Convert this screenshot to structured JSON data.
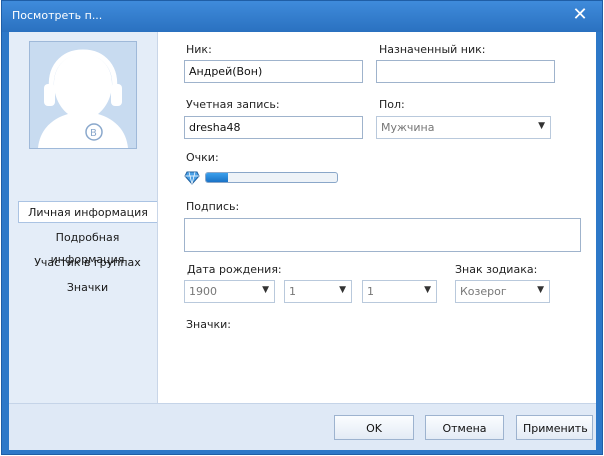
{
  "window": {
    "title": "Посмотреть п..."
  },
  "sidebar": {
    "items": [
      {
        "label": "Личная информация",
        "active": true
      },
      {
        "label": "Подробная информация",
        "active": false
      },
      {
        "label": "Участик в группах",
        "active": false
      },
      {
        "label": "Значки",
        "active": false
      }
    ]
  },
  "form": {
    "nick": {
      "label": "Ник:",
      "value": "Андрей(Вон)"
    },
    "assigned_nick": {
      "label": "Назначенный ник:",
      "value": ""
    },
    "account": {
      "label": "Учетная запись:",
      "value": "dresha48"
    },
    "gender": {
      "label": "Пол:",
      "value": "Мужчина"
    },
    "points": {
      "label": "Очки:",
      "progress_fraction": 0.17
    },
    "signature": {
      "label": "Подпись:",
      "value": ""
    },
    "birthdate": {
      "label": "Дата рождения:",
      "year": "1900",
      "month": "1",
      "day": "1"
    },
    "zodiac": {
      "label": "Знак зодиака:",
      "value": "Козерог"
    },
    "badges": {
      "label": "Значки:"
    }
  },
  "footer": {
    "ok": "OK",
    "cancel": "Отмена",
    "apply": "Применить"
  },
  "colors": {
    "title_bar": "#2d78c8",
    "progress_fill": "#1a72c6"
  }
}
